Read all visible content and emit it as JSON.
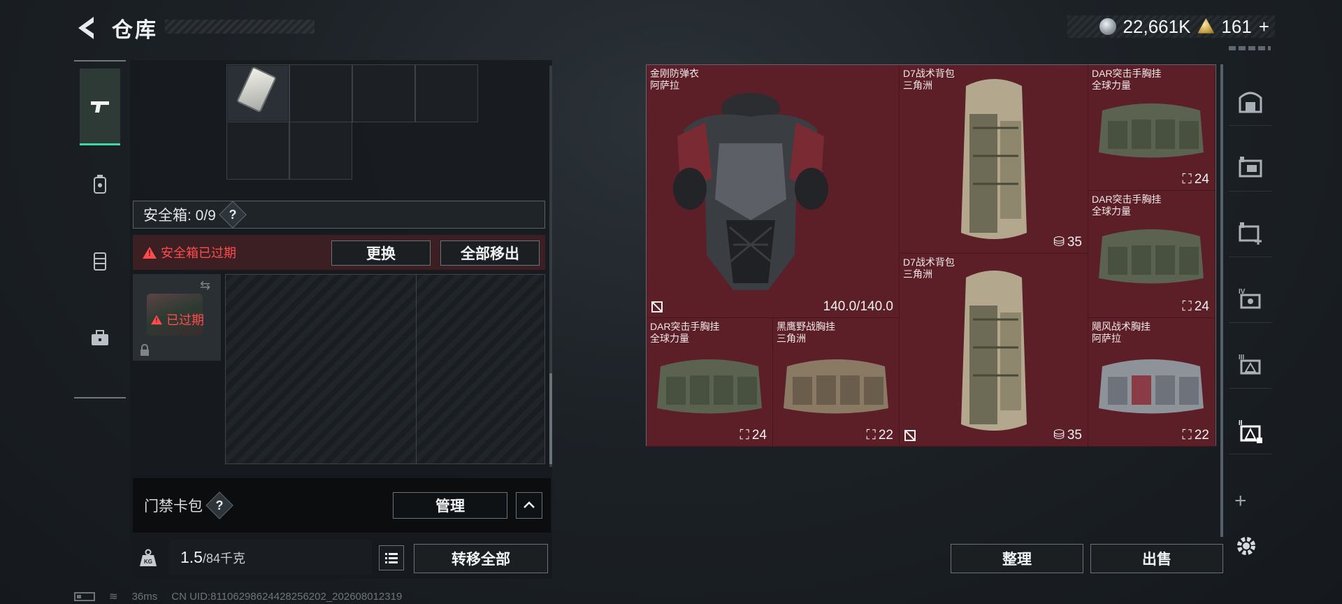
{
  "header": {
    "title": "仓库",
    "currency_silver": "22,661K",
    "currency_gold": "161",
    "gold_plus": "+"
  },
  "left_nav": [
    "pistol-icon",
    "bomb-icon",
    "vest-icon",
    "toolbox-icon"
  ],
  "safebox": {
    "label": "安全箱: 0/9",
    "help": "?",
    "expired_message": "安全箱已过期",
    "swap_label": "更换",
    "remove_all_label": "全部移出",
    "expired_badge": "已过期"
  },
  "keycard": {
    "label": "门禁卡包",
    "help": "?",
    "manage_label": "管理"
  },
  "weight": {
    "value": "1.5",
    "capacity": "/84千克",
    "transfer_all_label": "转移全部"
  },
  "status": {
    "ping": "36ms",
    "uid": "CN UID:81106298624428256202_202608012319"
  },
  "stash": {
    "items": [
      {
        "id": "armor",
        "name": "金刚防弹衣",
        "origin": "阿萨拉",
        "qty": "140.0/140.0"
      },
      {
        "id": "backpack1",
        "name": "D7战术背包",
        "origin": "三角洲",
        "qty": "35"
      },
      {
        "id": "rig1",
        "name": "DAR突击手胸挂",
        "origin": "全球力量",
        "qty": "24"
      },
      {
        "id": "rig2",
        "name": "DAR突击手胸挂",
        "origin": "全球力量",
        "qty": "24"
      },
      {
        "id": "backpack2",
        "name": "D7战术背包",
        "origin": "三角洲",
        "qty": "35"
      },
      {
        "id": "rig3",
        "name": "DAR突击手胸挂",
        "origin": "全球力量",
        "qty": "24"
      },
      {
        "id": "rig4",
        "name": "黑鹰野战胸挂",
        "origin": "三角洲",
        "qty": "22"
      },
      {
        "id": "rig5",
        "name": "飓风战术胸挂",
        "origin": "阿萨拉",
        "qty": "22"
      }
    ],
    "sort_label": "整理",
    "sell_label": "出售"
  },
  "right_nav": [
    "safe-icon",
    "folder-stash-icon",
    "stash-add-icon",
    "stash-iv-icon",
    "stash-iii-icon",
    "stash-active-icon"
  ],
  "colors": {
    "accent": "#43d6a5",
    "expired_red": "#ff4b4b",
    "item_cell": "#5c1e27"
  }
}
